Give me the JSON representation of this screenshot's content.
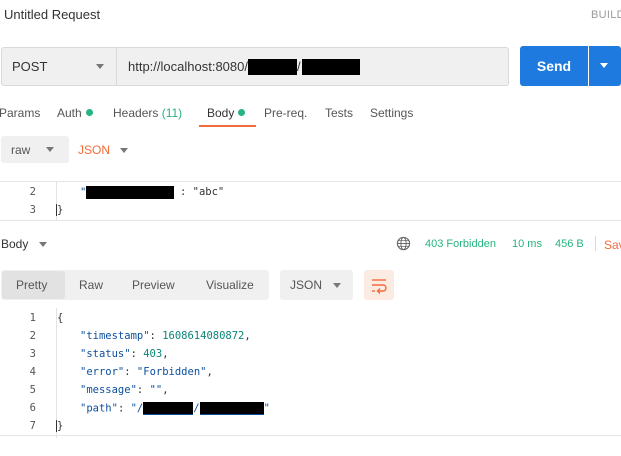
{
  "header": {
    "title": "Untitled Request",
    "build": "BUILD"
  },
  "request": {
    "method": "POST",
    "url_prefix": "http://localhost:8080/",
    "url_sep": "/",
    "send_label": "Send"
  },
  "tabs": [
    {
      "label": "Params",
      "dot": false
    },
    {
      "label": "Auth",
      "dot": true
    },
    {
      "label": "Headers",
      "count": "(11)"
    },
    {
      "label": "Body",
      "dot": true,
      "active": true
    },
    {
      "label": "Pre-req.",
      "dot": false
    },
    {
      "label": "Tests",
      "dot": false
    },
    {
      "label": "Settings",
      "dot": false
    }
  ],
  "body_options": {
    "mode": "raw",
    "type": "JSON"
  },
  "request_editor": {
    "lines": [
      {
        "num": "2",
        "value": ": \"abc\""
      },
      {
        "num": "3",
        "text": "}"
      }
    ]
  },
  "response": {
    "body_label": "Body",
    "status": "403 Forbidden",
    "time": "10 ms",
    "size": "456 B",
    "save_label": "Save",
    "view_tabs": [
      "Pretty",
      "Raw",
      "Preview",
      "Visualize"
    ],
    "format": "JSON",
    "lines": [
      {
        "num": "1",
        "text": "{"
      },
      {
        "num": "2",
        "key": "\"timestamp\"",
        "value": "1608614080872",
        "trail": ","
      },
      {
        "num": "3",
        "key": "\"status\"",
        "value": "403",
        "trail": ","
      },
      {
        "num": "4",
        "key": "\"error\"",
        "value": "\"Forbidden\"",
        "trail": ","
      },
      {
        "num": "5",
        "key": "\"message\"",
        "value": "\"\"",
        "trail": ","
      },
      {
        "num": "6",
        "key": "\"path\"",
        "value_open": "\"/",
        "value_mid": "/",
        "value_close": "\""
      },
      {
        "num": "7",
        "text": "}"
      }
    ]
  },
  "colors": {
    "accent_orange": "#f26b3a",
    "send_blue": "#1f7ae0",
    "status_green": "#26b47f",
    "string_blue": "#0b4f9c",
    "number_teal": "#0b8577"
  },
  "icons": {
    "method_dropdown": "chevron-down-icon",
    "send_dropdown": "chevron-down-icon",
    "network": "globe-icon",
    "wrap": "wrap-lines-icon"
  }
}
